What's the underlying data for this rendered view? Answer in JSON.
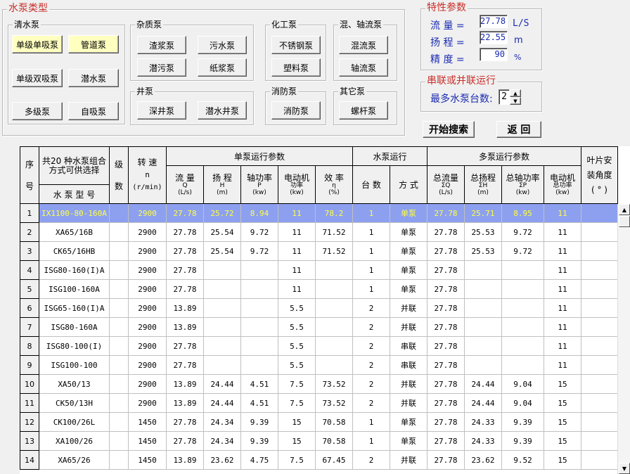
{
  "pump_type": {
    "title": "水泵类型",
    "clear_water": {
      "title": "清水泵",
      "buttons": [
        "单级单吸泵",
        "管道泵",
        "单级双吸泵",
        "潜水泵",
        "多级泵",
        "自吸泵"
      ]
    },
    "impurity": {
      "title": "杂质泵",
      "buttons": [
        "渣浆泵",
        "污水泵",
        "潜污泵",
        "纸浆泵"
      ]
    },
    "chemical": {
      "title": "化工泵",
      "buttons": [
        "不锈钢泵",
        "塑料泵"
      ]
    },
    "mixed_axial": {
      "title": "混、轴流泵",
      "buttons": [
        "混流泵",
        "轴流泵"
      ]
    },
    "well": {
      "title": "井泵",
      "buttons": [
        "深井泵",
        "潜水井泵"
      ]
    },
    "fire": {
      "title": "消防泵",
      "buttons": [
        "消防泵"
      ]
    },
    "other": {
      "title": "其它泵",
      "buttons": [
        "螺杆泵"
      ]
    }
  },
  "params": {
    "title": "特性参数",
    "flow_label": "流  量 =",
    "flow_value": "27.78",
    "flow_unit": "L/S",
    "head_label": "扬  程 =",
    "head_value": "22.55",
    "head_unit": "m",
    "prec_label": "精  度 =",
    "prec_value": "90",
    "prec_unit": "%"
  },
  "series": {
    "title": "串联或并联运行",
    "max_label": "最多水泵台数:",
    "max_value": "2"
  },
  "actions": {
    "search": "开始搜索",
    "back": "返  回"
  },
  "grid": {
    "headers": {
      "seq": "序",
      "seq2": "号",
      "model_top": "共20 种水泵组合方式可供选择",
      "model": "水 泵 型 号",
      "stage": "级",
      "stage2": "数",
      "speed": "转  速",
      "speed2": "n",
      "speed3": "(r/min)",
      "single": "单泵运行参数",
      "flow": "流  量",
      "flow_s": "Q",
      "flow_u": "(L/s)",
      "head": "扬  程",
      "head_s": "H",
      "head_u": "(m)",
      "shaft": "轴功率",
      "shaft_s": "P",
      "shaft_u": "(kw)",
      "motor": "电动机",
      "motor_s": "功率",
      "motor_u": "(kw)",
      "eff": "效  率",
      "eff_s": "η",
      "eff_u": "(%)",
      "run": "水泵运行",
      "count": "台  数",
      "mode": "方  式",
      "multi": "多泵运行参数",
      "tflow": "总流量",
      "tflow_s": "ΣQ",
      "tflow_u": "(L/s)",
      "thead": "总扬程",
      "thead_s": "ΣH",
      "thead_u": "(m)",
      "tshaft": "总轴功率",
      "tshaft_s": "ΣP",
      "tshaft_u": "(kw)",
      "tmotor": "电动机",
      "tmotor_s": "总功率",
      "tmotor_u": "(kw)",
      "blade": "叶片安",
      "blade2": "装角度",
      "blade3": "( ° )"
    },
    "rows": [
      [
        "1",
        "IX1100-80-160A",
        "",
        "2900",
        "27.78",
        "25.72",
        "8.94",
        "11",
        "78.2",
        "1",
        "单泵",
        "27.78",
        "25.71",
        "8.95",
        "11",
        ""
      ],
      [
        "2",
        "XA65/16B",
        "",
        "2900",
        "27.78",
        "25.54",
        "9.72",
        "11",
        "71.52",
        "1",
        "单泵",
        "27.78",
        "25.53",
        "9.72",
        "11",
        ""
      ],
      [
        "3",
        "CK65/16HB",
        "",
        "2900",
        "27.78",
        "25.54",
        "9.72",
        "11",
        "71.52",
        "1",
        "单泵",
        "27.78",
        "25.53",
        "9.72",
        "11",
        ""
      ],
      [
        "4",
        "ISG80-160(I)A",
        "",
        "2900",
        "27.78",
        "",
        "",
        "11",
        "",
        "1",
        "单泵",
        "27.78",
        "",
        "",
        "11",
        ""
      ],
      [
        "5",
        "ISG100-160A",
        "",
        "2900",
        "27.78",
        "",
        "",
        "11",
        "",
        "1",
        "单泵",
        "27.78",
        "",
        "",
        "11",
        ""
      ],
      [
        "6",
        "ISG65-160(I)A",
        "",
        "2900",
        "13.89",
        "",
        "",
        "5.5",
        "",
        "2",
        "并联",
        "27.78",
        "",
        "",
        "11",
        ""
      ],
      [
        "7",
        "ISG80-160A",
        "",
        "2900",
        "13.89",
        "",
        "",
        "5.5",
        "",
        "2",
        "并联",
        "27.78",
        "",
        "",
        "11",
        ""
      ],
      [
        "8",
        "ISG80-100(I)",
        "",
        "2900",
        "27.78",
        "",
        "",
        "5.5",
        "",
        "2",
        "串联",
        "27.78",
        "",
        "",
        "11",
        ""
      ],
      [
        "9",
        "ISG100-100",
        "",
        "2900",
        "27.78",
        "",
        "",
        "5.5",
        "",
        "2",
        "串联",
        "27.78",
        "",
        "",
        "11",
        ""
      ],
      [
        "10",
        "XA50/13",
        "",
        "2900",
        "13.89",
        "24.44",
        "4.51",
        "7.5",
        "73.52",
        "2",
        "并联",
        "27.78",
        "24.44",
        "9.04",
        "15",
        ""
      ],
      [
        "11",
        "CK50/13H",
        "",
        "2900",
        "13.89",
        "24.44",
        "4.51",
        "7.5",
        "73.52",
        "2",
        "并联",
        "27.78",
        "24.44",
        "9.04",
        "15",
        ""
      ],
      [
        "12",
        "CK100/26L",
        "",
        "1450",
        "27.78",
        "24.34",
        "9.39",
        "15",
        "70.58",
        "1",
        "单泵",
        "27.78",
        "24.33",
        "9.39",
        "15",
        ""
      ],
      [
        "13",
        "XA100/26",
        "",
        "1450",
        "27.78",
        "24.34",
        "9.39",
        "15",
        "70.58",
        "1",
        "单泵",
        "27.78",
        "24.33",
        "9.39",
        "15",
        ""
      ],
      [
        "14",
        "XA65/26",
        "",
        "1450",
        "13.89",
        "23.62",
        "4.75",
        "7.5",
        "67.45",
        "2",
        "并联",
        "27.78",
        "23.62",
        "9.52",
        "15",
        ""
      ]
    ]
  }
}
